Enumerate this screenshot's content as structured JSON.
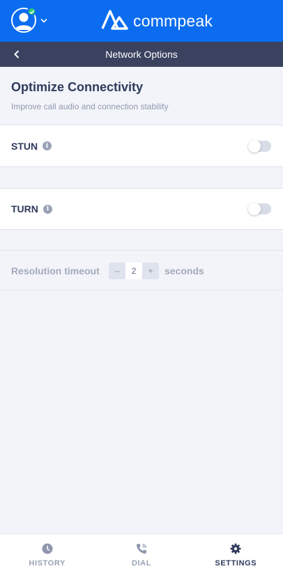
{
  "brand": {
    "name": "commpeak",
    "logo_icon": "commpeak-logo-icon",
    "color": "#0b6cf0"
  },
  "user": {
    "avatar_icon": "user-avatar-icon",
    "status": "online",
    "status_color": "#2ecb6c"
  },
  "header": {
    "title": "Network Options",
    "back_icon": "chevron-left-icon"
  },
  "section": {
    "title": "Optimize Connectivity",
    "subtitle": "Improve call audio and connection stability"
  },
  "settings": [
    {
      "label": "STUN",
      "enabled": false
    },
    {
      "label": "TURN",
      "enabled": false
    }
  ],
  "resolution_timeout": {
    "label": "Resolution timeout",
    "value": "2",
    "unit": "seconds",
    "decrement": "–",
    "increment": "+"
  },
  "nav": {
    "items": [
      {
        "label": "HISTORY",
        "icon": "clock-icon",
        "active": false
      },
      {
        "label": "DIAL",
        "icon": "phone-icon",
        "active": false
      },
      {
        "label": "SETTINGS",
        "icon": "gear-icon",
        "active": true
      }
    ]
  }
}
